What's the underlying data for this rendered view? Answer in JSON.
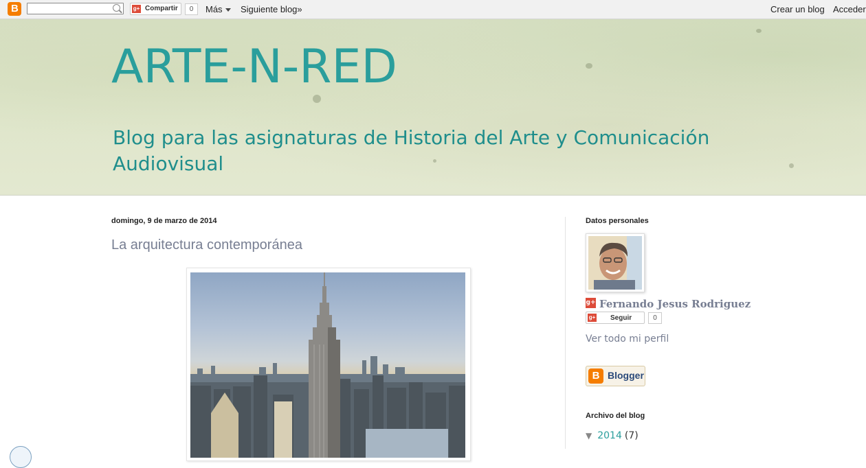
{
  "navbar": {
    "share_label": "Compartir",
    "share_count": "0",
    "more_label": "Más",
    "next_blog_label": "Siguiente blog»",
    "create_blog_label": "Crear un blog",
    "login_label": "Acceder"
  },
  "header": {
    "title": "ARTE-N-RED",
    "description": "Blog para las asignaturas de Historia del Arte y Comunicación Audiovisual"
  },
  "post": {
    "date": "domingo, 9 de marzo de 2014",
    "title": "La arquitectura contemporánea"
  },
  "sidebar": {
    "profile_heading": "Datos personales",
    "profile_name": "Fernando Jesus Rodriguez",
    "follow_label": "Seguir",
    "follow_count": "0",
    "profile_link": "Ver todo mi perfil",
    "blogger_badge": "Blogger",
    "archive_heading": "Archivo del blog",
    "archive_year": "2014",
    "archive_count": "(7)"
  },
  "colors": {
    "title": "#2a9e9c",
    "link": "#777e92",
    "blogger_orange": "#f57d00",
    "gplus_red": "#dd4b39"
  }
}
